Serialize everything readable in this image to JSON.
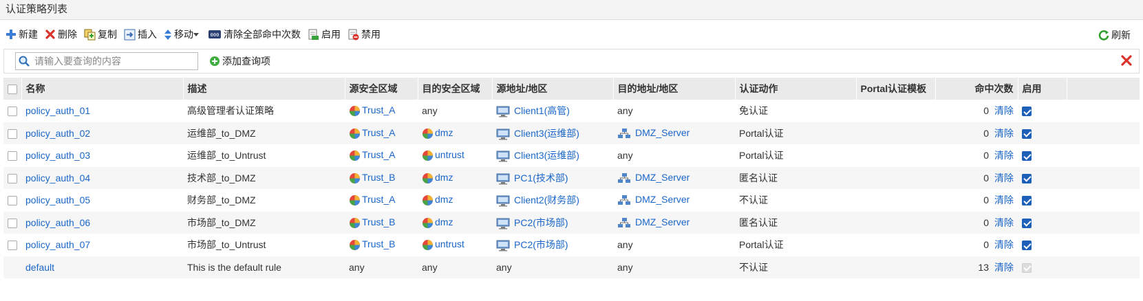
{
  "title": "认证策略列表",
  "toolbar": {
    "new": "新建",
    "delete": "删除",
    "copy": "复制",
    "insert": "插入",
    "move": "移动",
    "clear_hits": "清除全部命中次数",
    "enable": "启用",
    "disable": "禁用",
    "refresh": "刷新"
  },
  "search": {
    "placeholder": "请输入要查询的内容",
    "add_query": "添加查询项"
  },
  "columns": {
    "name": "名称",
    "desc": "描述",
    "src_zone": "源安全区域",
    "dst_zone": "目的安全区域",
    "src_addr": "源地址/地区",
    "dst_addr": "目的地址/地区",
    "action": "认证动作",
    "portal": "Portal认证模板",
    "hits": "命中次数",
    "enable": "启用"
  },
  "clear_label": "清除",
  "rows": [
    {
      "name": "policy_auth_01",
      "desc": "高级管理者认证策略",
      "src_zone": "Trust_A",
      "dst_zone": "any",
      "src_addr": "Client1(高管)",
      "dst_addr": "any",
      "action": "免认证",
      "portal": "",
      "hits": "0",
      "enabled": true
    },
    {
      "name": "policy_auth_02",
      "desc": "运维部_to_DMZ",
      "src_zone": "Trust_A",
      "dst_zone": "dmz",
      "src_addr": "Client3(运维部)",
      "dst_addr": "DMZ_Server",
      "action": "Portal认证",
      "portal": "",
      "hits": "0",
      "enabled": true
    },
    {
      "name": "policy_auth_03",
      "desc": "运维部_to_Untrust",
      "src_zone": "Trust_A",
      "dst_zone": "untrust",
      "src_addr": "Client3(运维部)",
      "dst_addr": "any",
      "action": "Portal认证",
      "portal": "",
      "hits": "0",
      "enabled": true
    },
    {
      "name": "policy_auth_04",
      "desc": "技术部_to_DMZ",
      "src_zone": "Trust_B",
      "dst_zone": "dmz",
      "src_addr": "PC1(技术部)",
      "dst_addr": "DMZ_Server",
      "action": "匿名认证",
      "portal": "",
      "hits": "0",
      "enabled": true
    },
    {
      "name": "policy_auth_05",
      "desc": "财务部_to_DMZ",
      "src_zone": "Trust_A",
      "dst_zone": "dmz",
      "src_addr": "Client2(财务部)",
      "dst_addr": "DMZ_Server",
      "action": "不认证",
      "portal": "",
      "hits": "0",
      "enabled": true
    },
    {
      "name": "policy_auth_06",
      "desc": "市场部_to_DMZ",
      "src_zone": "Trust_B",
      "dst_zone": "dmz",
      "src_addr": "PC2(市场部)",
      "dst_addr": "DMZ_Server",
      "action": "匿名认证",
      "portal": "",
      "hits": "0",
      "enabled": true
    },
    {
      "name": "policy_auth_07",
      "desc": "市场部_to_Untrust",
      "src_zone": "Trust_B",
      "dst_zone": "untrust",
      "src_addr": "PC2(市场部)",
      "dst_addr": "any",
      "action": "Portal认证",
      "portal": "",
      "hits": "0",
      "enabled": true
    },
    {
      "name": "default",
      "desc": "This is the default rule",
      "src_zone": "any",
      "dst_zone": "any",
      "src_addr": "any",
      "dst_addr": "any",
      "action": "不认证",
      "portal": "",
      "hits": "13",
      "enabled": true,
      "is_default": true
    }
  ]
}
